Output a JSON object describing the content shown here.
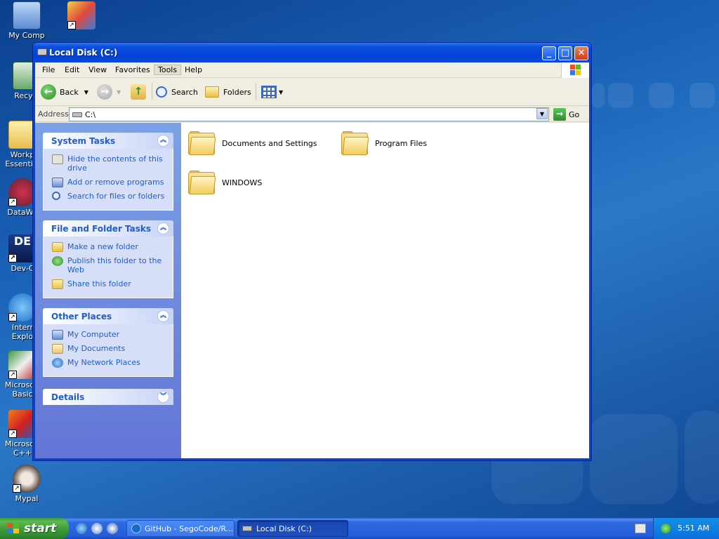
{
  "desktop": {
    "icons": [
      {
        "label": "My Computer",
        "icon": "my-computer-icon"
      },
      {
        "label": "Paint",
        "icon": "paint-icon"
      },
      {
        "label": "Recycle Bin",
        "icon": "recycle-bin-icon"
      },
      {
        "label": "Workplace Essentials",
        "icon": "folder-icon"
      },
      {
        "label": "DataWarrior",
        "icon": "datawarrior-icon"
      },
      {
        "label": "Dev-C++",
        "icon": "dev-cpp-icon"
      },
      {
        "label": "Internet Explorer",
        "icon": "internet-explorer-icon"
      },
      {
        "label": "Microsoft Visual Basic",
        "icon": "visual-basic-icon"
      },
      {
        "label": "Microsoft Visual C++",
        "icon": "visual-cpp-icon"
      },
      {
        "label": "Mypal",
        "icon": "mypal-icon"
      }
    ],
    "visible_labels": {
      "my_computer": "My Comp",
      "recycle": "Recycl",
      "workplace": "Workp\nEssential",
      "datawarrior": "DataWa",
      "devcpp": "Dev-C",
      "ie": "Interr\nExplo",
      "vb": "Microsoft\nBasic",
      "vcpp": "Microsoft\nC++",
      "mypal": "Mypal"
    }
  },
  "window": {
    "title": "Local Disk (C:)",
    "menu": [
      "File",
      "Edit",
      "View",
      "Favorites",
      "Tools",
      "Help"
    ],
    "toolbar": {
      "back": "Back",
      "search": "Search",
      "folders": "Folders"
    },
    "address": {
      "label": "Address",
      "value": "C:\\",
      "go": "Go"
    },
    "task_pane": {
      "system_tasks": {
        "title": "System Tasks",
        "items": [
          "Hide the contents of this drive",
          "Add or remove programs",
          "Search for files or folders"
        ]
      },
      "file_folder_tasks": {
        "title": "File and Folder Tasks",
        "items": [
          "Make a new folder",
          "Publish this folder to the Web",
          "Share this folder"
        ]
      },
      "other_places": {
        "title": "Other Places",
        "items": [
          "My Computer",
          "My Documents",
          "My Network Places"
        ]
      },
      "details": {
        "title": "Details"
      }
    },
    "files": [
      "Documents and Settings",
      "Program Files",
      "WINDOWS"
    ]
  },
  "taskbar": {
    "start": "start",
    "buttons": [
      "GitHub - SegoCode/R...",
      "Local Disk (C:)"
    ],
    "clock": "5:51 AM"
  },
  "colors": {
    "link": "#215dc6",
    "panel_body": "#d6dff7",
    "title_bar": "#0541d8",
    "start_green": "#379937"
  }
}
